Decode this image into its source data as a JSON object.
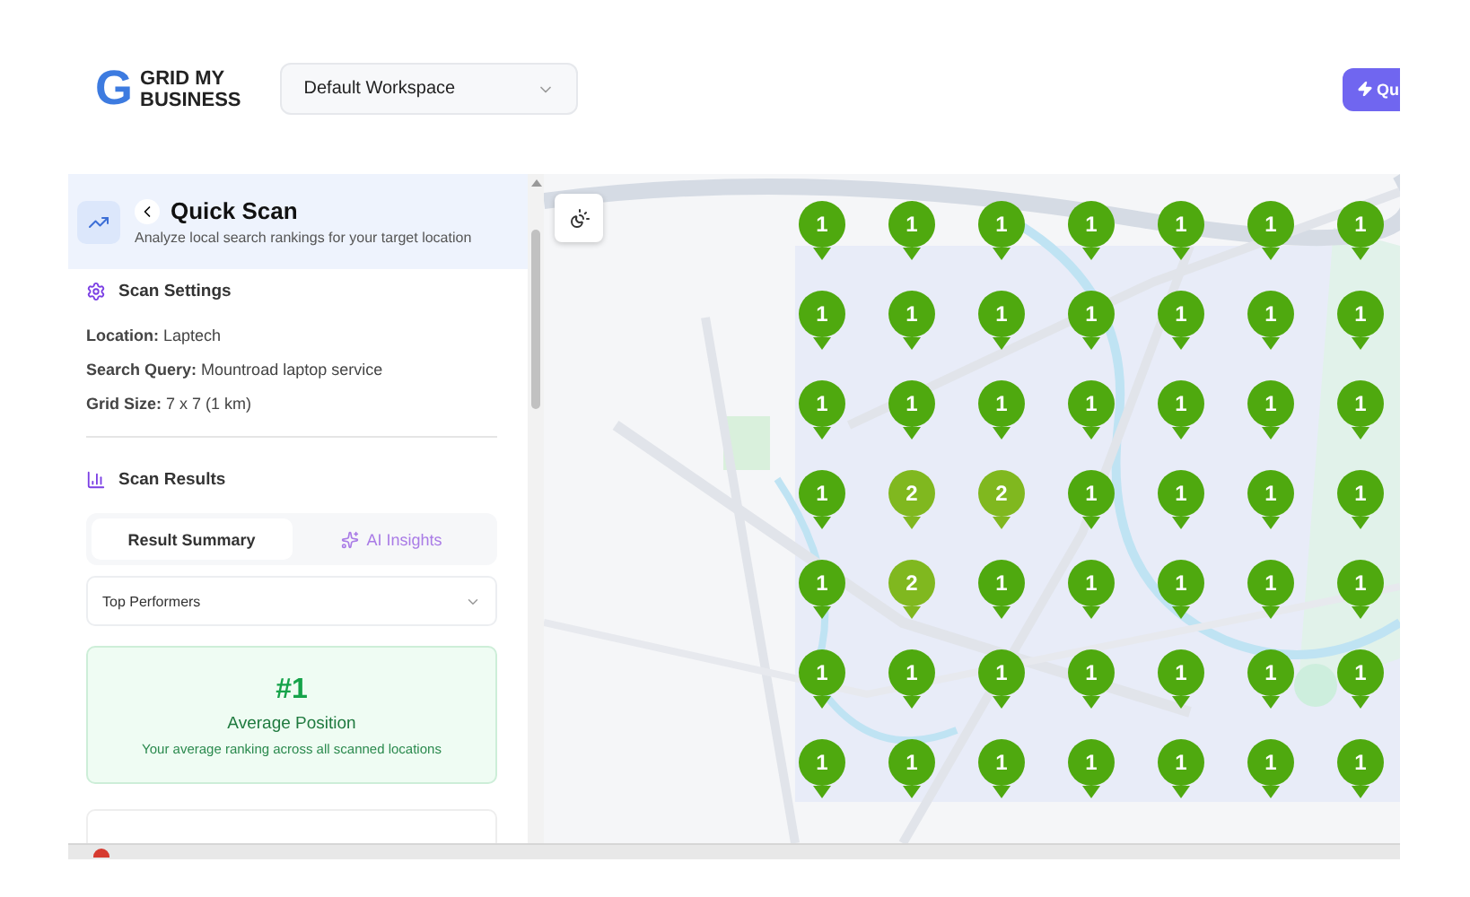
{
  "header": {
    "logo_letter": "G",
    "logo_text": [
      "GRID MY",
      "BUSINESS"
    ],
    "workspace": "Default Workspace",
    "action_button": "Qu"
  },
  "panel": {
    "title": "Quick Scan",
    "subtitle": "Analyze local search rankings for your target location",
    "settings": {
      "heading": "Scan Settings",
      "items": [
        {
          "label": "Location:",
          "value": "Laptech"
        },
        {
          "label": "Search Query:",
          "value": "Mountroad laptop service"
        },
        {
          "label": "Grid Size:",
          "value": "7 x 7 (1 km)"
        }
      ]
    },
    "results": {
      "heading": "Scan Results",
      "tabs": [
        {
          "label": "Result Summary",
          "kind": "plain",
          "selected": true
        },
        {
          "label": "AI Insights",
          "kind": "ai",
          "selected": false
        }
      ],
      "filter": "Top Performers",
      "summary": {
        "rank": "#1",
        "label": "Average Position",
        "note": "Your average ranking across all scanned locations"
      }
    }
  },
  "map": {
    "kind": "picture",
    "grid": [
      [
        "1",
        "1",
        "1",
        "1",
        "1",
        "1",
        "1"
      ],
      [
        "1",
        "1",
        "1",
        "1",
        "1",
        "1",
        "1"
      ],
      [
        "1",
        "1",
        "1",
        "1",
        "1",
        "1",
        "1"
      ],
      [
        "1",
        "2",
        "2",
        "1",
        "1",
        "1",
        "1"
      ],
      [
        "1",
        "2",
        "1",
        "1",
        "1",
        "1",
        "1"
      ],
      [
        "1",
        "1",
        "1",
        "1",
        "1",
        "1",
        "1"
      ],
      [
        "1",
        "1",
        "1",
        "1",
        "1",
        "1",
        "1"
      ]
    ]
  }
}
